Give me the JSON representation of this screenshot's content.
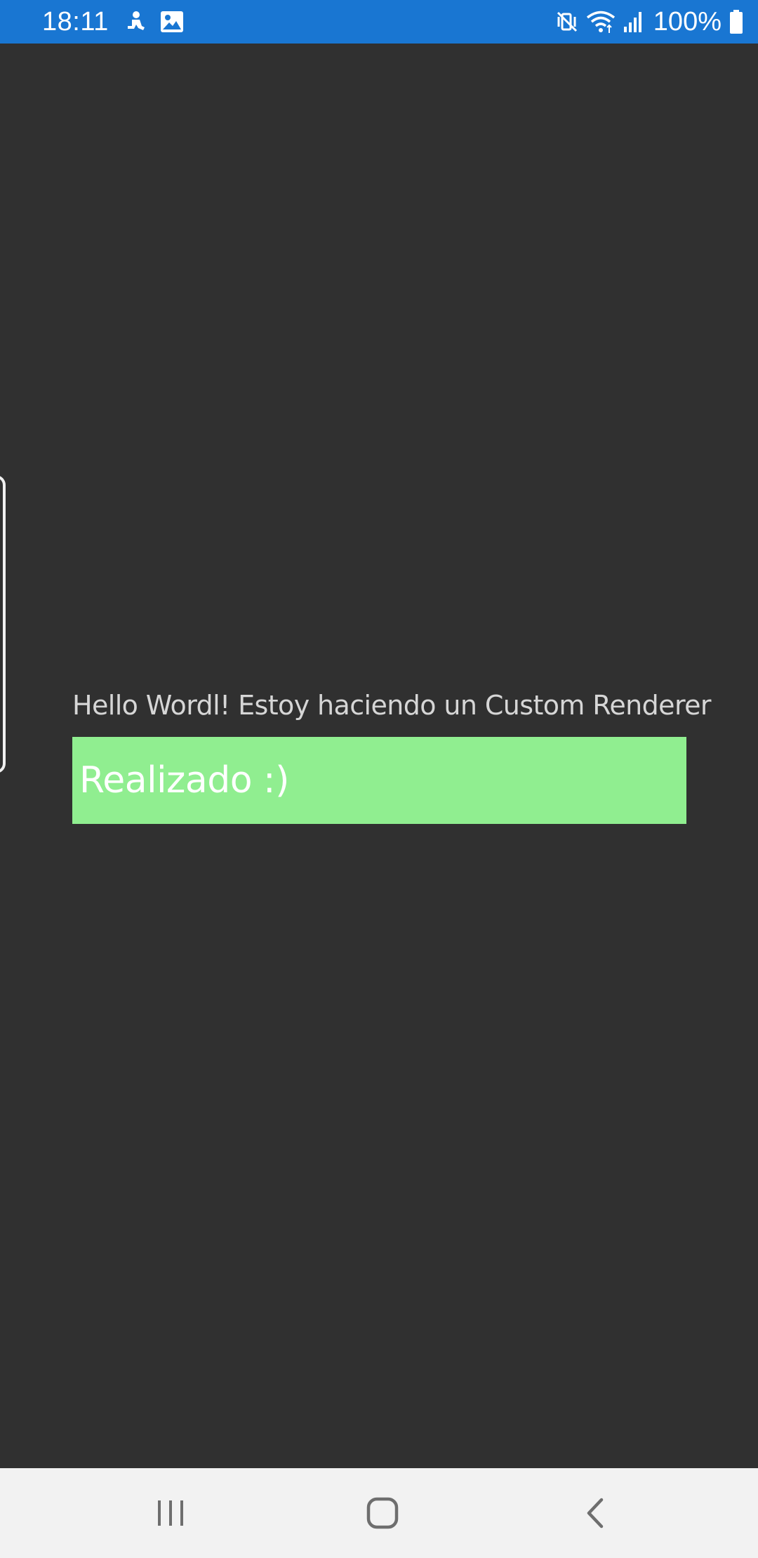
{
  "status_bar": {
    "time": "18:11",
    "battery_percent": "100%",
    "background_color": "#1976D2",
    "left_icons": [
      "user-activity-icon",
      "image-notification-icon"
    ],
    "right_icons": [
      "mute-vibrate-icon",
      "wifi-icon",
      "cell-signal-icon",
      "battery-icon"
    ]
  },
  "main": {
    "background_color": "#303030",
    "label_text": "Hello Wordl! Estoy haciendo un Custom Renderer",
    "button_label": "Realizado :)",
    "button_color": "#90EE90"
  },
  "nav_bar": {
    "background_color": "#f2f2f2",
    "buttons": [
      "recents-icon",
      "home-icon",
      "back-icon"
    ]
  }
}
